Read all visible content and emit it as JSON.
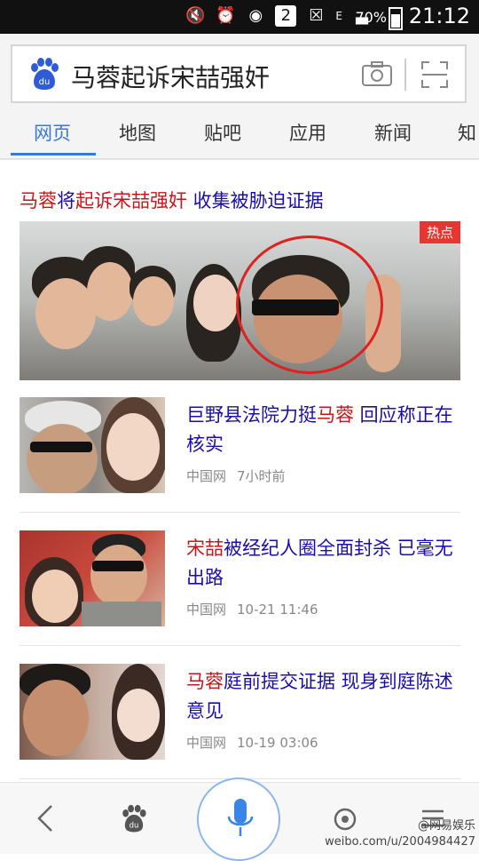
{
  "status_bar": {
    "network_label": "E",
    "sim_badge": "2",
    "battery": "70%",
    "time": "21:12"
  },
  "search": {
    "query": "马蓉起诉宋喆强奸"
  },
  "tabs": [
    {
      "label": "网页",
      "active": true
    },
    {
      "label": "地图"
    },
    {
      "label": "贴吧"
    },
    {
      "label": "应用"
    },
    {
      "label": "新闻"
    },
    {
      "label": "知"
    }
  ],
  "featured": {
    "headline_parts": [
      "马蓉",
      "将",
      "起诉宋喆强奸",
      " 收集被胁迫证据"
    ],
    "badge": "热点"
  },
  "news": [
    {
      "title_parts": [
        "巨野县法院力挺",
        "马蓉",
        " 回应称正在核实"
      ],
      "source": "中国网",
      "time": "7小时前"
    },
    {
      "title_parts": [
        "宋喆",
        "被经纪人圈全面封杀 已毫无出路"
      ],
      "source": "中国网",
      "time": "10-21 11:46"
    },
    {
      "title_parts": [
        "马蓉",
        "庭前提交证据 现身到庭陈述意见"
      ],
      "source": "中国网",
      "time": "10-19 03:06"
    }
  ],
  "bottom": {
    "logo_text": "du"
  },
  "watermark": {
    "line1": "@网易娱乐",
    "line2": "weibo.com/u/2004984427"
  },
  "colors": {
    "accent": "#3a78d8",
    "highlight": "#c4171b",
    "link": "#1a0dab",
    "hot": "#e8352f"
  }
}
